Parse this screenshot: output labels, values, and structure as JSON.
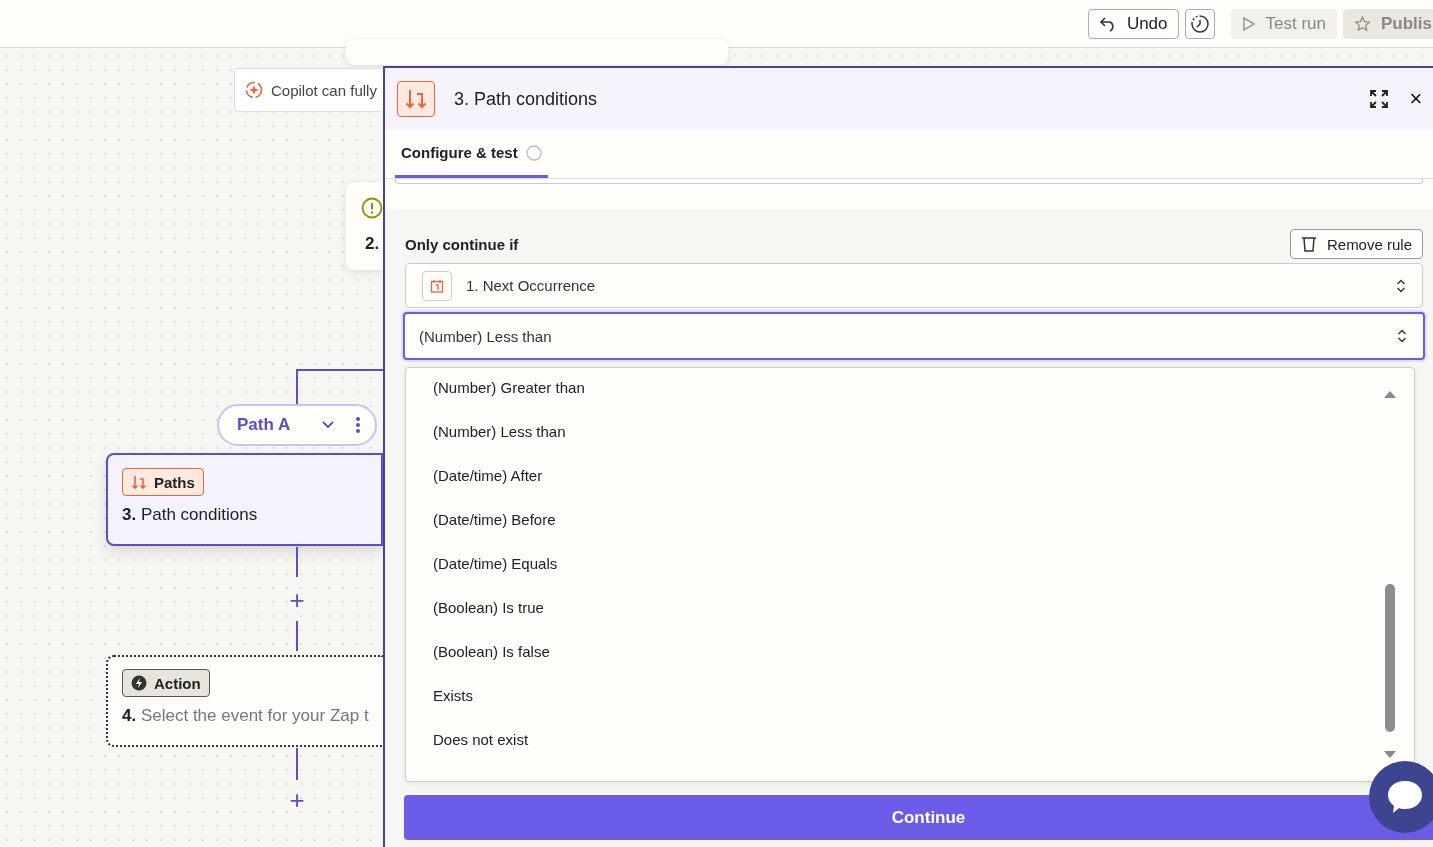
{
  "toolbar": {
    "undo": "Undo",
    "test_run": {
      "label": "Test run",
      "disabled": true
    },
    "publish": {
      "label": "Publis",
      "disabled": true
    }
  },
  "canvas": {
    "copilot": "Copilot can fully",
    "step_2": "2.",
    "path_pill": "Path A",
    "paths_node": {
      "badge": "Paths",
      "number": "3.",
      "title": "Path conditions",
      "selected": true
    },
    "action_node": {
      "badge": "Action",
      "number": "4.",
      "title": "Select the event for your Zap t",
      "selected": false
    },
    "add_buttons": [
      "+",
      "+"
    ]
  },
  "panel": {
    "title": "3. Path conditions",
    "close": "×",
    "tabs": [
      {
        "label": "Configure & test",
        "selected": true
      }
    ],
    "rule": {
      "heading": "Only continue if",
      "remove": "Remove rule",
      "field": "1. Next Occurrence",
      "condition": "(Number) Less than",
      "options": [
        "(Number) Greater than",
        "(Number) Less than",
        "(Date/time) After",
        "(Date/time) Before",
        "(Date/time) Equals",
        "(Boolean) Is true",
        "(Boolean) Is false",
        "Exists",
        "Does not exist"
      ]
    },
    "continue": "Continue"
  }
}
